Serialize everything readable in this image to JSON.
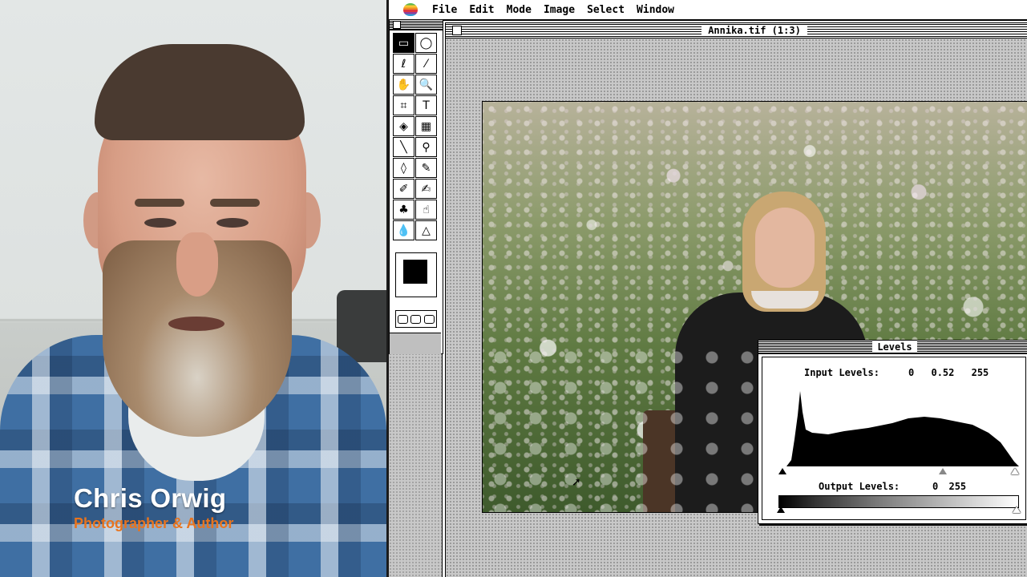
{
  "presenter": {
    "name": "Chris Orwig",
    "title": "Photographer & Author"
  },
  "menubar": {
    "items": [
      "File",
      "Edit",
      "Mode",
      "Image",
      "Select",
      "Window"
    ]
  },
  "document": {
    "title": "Annika.tif (1:3)"
  },
  "toolbox": {
    "tools": [
      {
        "icon": "marquee-icon",
        "glyph": "▭"
      },
      {
        "icon": "ellipse-marquee-icon",
        "glyph": "◯"
      },
      {
        "icon": "lasso-icon",
        "glyph": "ℓ"
      },
      {
        "icon": "magic-wand-icon",
        "glyph": "⁄"
      },
      {
        "icon": "hand-icon",
        "glyph": "✋"
      },
      {
        "icon": "zoom-icon",
        "glyph": "🔍"
      },
      {
        "icon": "crop-icon",
        "glyph": "⌗"
      },
      {
        "icon": "type-icon",
        "glyph": "T"
      },
      {
        "icon": "paint-bucket-icon",
        "glyph": "◈"
      },
      {
        "icon": "gradient-icon",
        "glyph": "▦"
      },
      {
        "icon": "line-icon",
        "glyph": "╲"
      },
      {
        "icon": "eyedropper-icon",
        "glyph": "⚲"
      },
      {
        "icon": "eraser-icon",
        "glyph": "◊"
      },
      {
        "icon": "pencil-icon",
        "glyph": "✎"
      },
      {
        "icon": "airbrush-icon",
        "glyph": "✐"
      },
      {
        "icon": "paintbrush-icon",
        "glyph": "✍"
      },
      {
        "icon": "rubber-stamp-icon",
        "glyph": "♣"
      },
      {
        "icon": "smudge-icon",
        "glyph": "☝"
      },
      {
        "icon": "blur-icon",
        "glyph": "💧"
      },
      {
        "icon": "sharpen-icon",
        "glyph": "△"
      }
    ],
    "selected_index": 0,
    "foreground_color": "#000000"
  },
  "levels": {
    "title": "Levels",
    "input_label": "Input Levels:",
    "input_black": "0",
    "input_gamma": "0.52",
    "input_white": "255",
    "output_label": "Output Levels:",
    "output_black": "0",
    "output_white": "255",
    "input_gamma_position": 0.69
  }
}
